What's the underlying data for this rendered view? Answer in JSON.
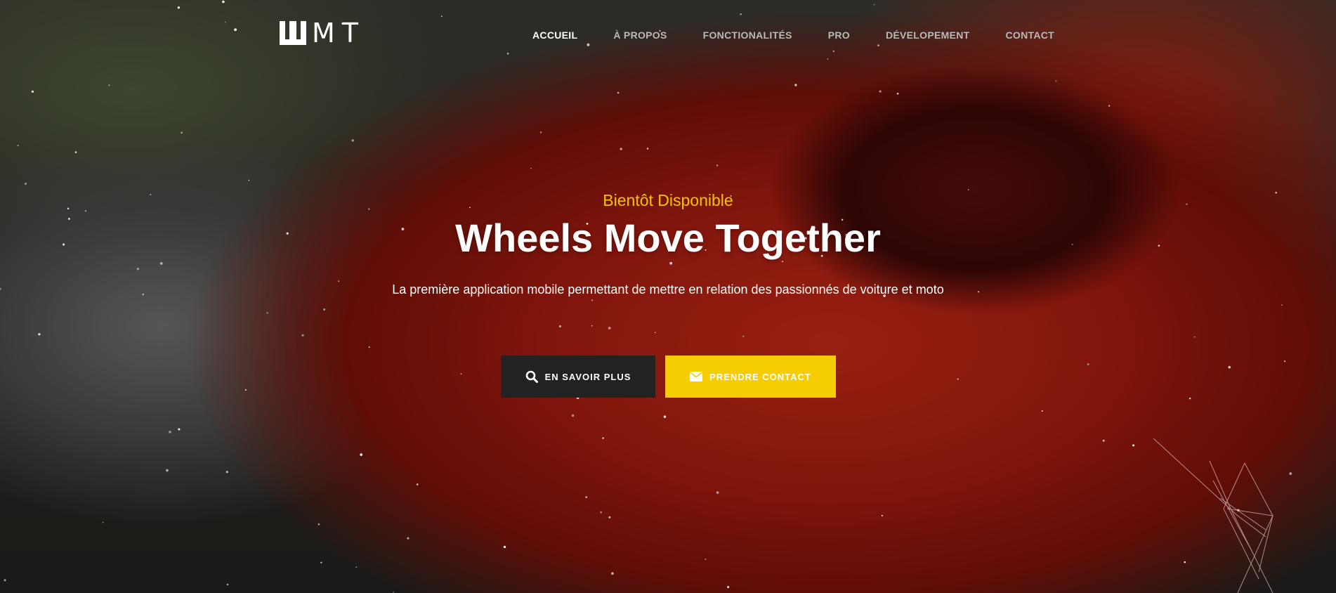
{
  "brand": {
    "logo_text": "MT",
    "logo_mark": "W"
  },
  "nav": {
    "items": [
      {
        "label": "ACCUEIL",
        "active": true
      },
      {
        "label": "À PROPOS",
        "active": false
      },
      {
        "label": "FONCTIONALITÉS",
        "active": false
      },
      {
        "label": "PRO",
        "active": false
      },
      {
        "label": "DÉVELOPEMENT",
        "active": false
      },
      {
        "label": "CONTACT",
        "active": false
      }
    ]
  },
  "hero": {
    "tagline": "Bientôt Disponible",
    "headline": "Wheels Move Together",
    "description": "La première application mobile permettant de mettre en relation des passionnés de voiture et moto"
  },
  "buttons": {
    "more": {
      "label": "EN SAVOIR PLUS",
      "icon": "search-icon"
    },
    "contact": {
      "label": "PRENDRE CONTACT",
      "icon": "envelope-icon"
    }
  },
  "colors": {
    "accent": "#f5cd00",
    "tagline": "#f2c400",
    "dark_button": "#222222",
    "nav_inactive": "#b9b9b9",
    "nav_active": "#ffffff"
  }
}
